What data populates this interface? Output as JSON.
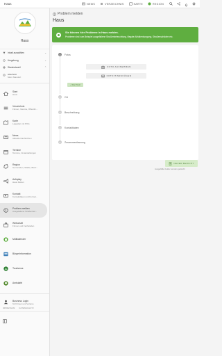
{
  "topbar": {
    "brand": "Haus",
    "nav": [
      {
        "icon": "newspaper-icon",
        "label": "NEWS"
      },
      {
        "icon": "list-icon",
        "label": "VERZEICHNIS"
      },
      {
        "icon": "map-icon",
        "label": "KARTE"
      },
      {
        "icon": "region-icon",
        "label": "REGION"
      }
    ]
  },
  "sidebar": {
    "title": "Haus",
    "filters": [
      {
        "label": "Inhalt auswählen"
      },
      {
        "label": "Umgebung"
      },
      {
        "label": "Standortwahl"
      }
    ],
    "location": {
      "title": "Abschnitt",
      "sub": "Mein Standort"
    },
    "items": [
      {
        "icon": "home-icon",
        "label": "Start",
        "sub": "Haus"
      },
      {
        "icon": "list-icon",
        "label": "Verzeichnis",
        "sub": "Firmen, Vereine, Öffentlic..."
      },
      {
        "icon": "map-icon",
        "label": "Karte",
        "sub": "Lageplan mit POIs"
      },
      {
        "icon": "newspaper-icon",
        "label": "News",
        "sub": "Aktuelle Nachrichten"
      },
      {
        "icon": "calendar-icon",
        "label": "Termine",
        "sub": "Termine, Veranstaltungen"
      },
      {
        "icon": "region-icon",
        "label": "Region",
        "sub": "Gemeinden, Städte, Bezir..."
      },
      {
        "icon": "megaphone-icon",
        "label": "Aufsplay",
        "sub": "Haus Reben"
      },
      {
        "icon": "contact-icon",
        "label": "Kontakt",
        "sub": "Kontaktdaten und Formul..."
      },
      {
        "icon": "alert-icon",
        "label": "Problem melden",
        "sub": "Ausgefallene Straßenbel..."
      },
      {
        "icon": "economy-icon",
        "label": "Wirtschaft",
        "sub": "Firmen und Fachstellen"
      },
      {
        "icon": "trash-calendar-icon",
        "label": "Müllkalender",
        "sub": ""
      },
      {
        "icon": "info-icon",
        "label": "Bürgerinformation",
        "sub": ""
      },
      {
        "icon": "tourism-icon",
        "label": "Tourismus",
        "sub": ""
      },
      {
        "icon": "board-icon",
        "label": "Amtstafel",
        "sub": ""
      },
      {
        "icon": "business-login-icon",
        "label": "Business Login",
        "sub": "für Firmen und Vereine"
      }
    ],
    "footer": [
      "IMPRESSUM",
      "DATENSCHUTZ"
    ]
  },
  "main": {
    "crumb": "Problem melden",
    "title": "Haus",
    "banner": {
      "heading": "Sie können hier Probleme in Haus melden.",
      "text": "Probleme sind zum Beispiel ausgefallene Straßenbeleuchtung, illegale Abfallentsorgung, Straßenschäden etc."
    },
    "steps": [
      {
        "num": "1",
        "label": "Fotos"
      },
      {
        "num": "2",
        "label": "Ort"
      },
      {
        "num": "3",
        "label": "Beschreibung"
      },
      {
        "num": "4",
        "label": "Kontaktdaten"
      },
      {
        "num": "5",
        "label": "Zusammenfassung"
      }
    ],
    "photo_buttons": [
      "FOTO AUFNEHMEN",
      "FOTO HINZUFÜGEN"
    ],
    "next_label": "WEITER",
    "new_report_label": "NEUER BERICHT",
    "hint": "Ausgefüllte Felder werden gelöscht"
  },
  "colors": {
    "accent": "#5fae40",
    "active_bg": "#e5e5e5",
    "alert": "#e7403a"
  }
}
